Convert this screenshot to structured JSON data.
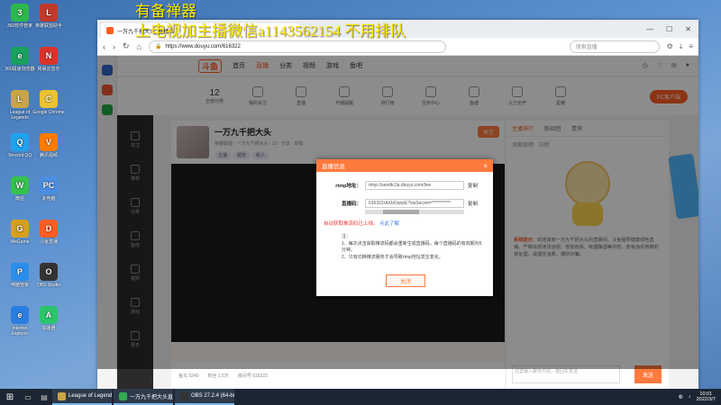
{
  "watermark": {
    "line1": "有备禅器",
    "line2": "上电视加主播微信a1143562154 不用排队"
  },
  "desktop_icons": [
    {
      "label": "360软件管家",
      "color": "#2db84d",
      "glyph": "3"
    },
    {
      "label": "360极速浏览器",
      "color": "#1aa15e",
      "glyph": "e"
    },
    {
      "label": "League of Legends",
      "color": "#caa546",
      "glyph": "L"
    },
    {
      "label": "Tencent QQ",
      "color": "#1fa2ef",
      "glyph": "Q"
    },
    {
      "label": "微信",
      "color": "#34c24d",
      "glyph": "W"
    },
    {
      "label": "WeGame",
      "color": "#d6a01d",
      "glyph": "G"
    },
    {
      "label": "电脑管家",
      "color": "#2b8eea",
      "glyph": "P"
    },
    {
      "label": "Internet Explorer",
      "color": "#2b7de0",
      "glyph": "e"
    },
    {
      "label": "英雄联盟助手",
      "color": "#c0392b",
      "glyph": "L"
    },
    {
      "label": "网易云音乐",
      "color": "#d9342b",
      "glyph": "N"
    },
    {
      "label": "Google Chrome",
      "color": "#eac233",
      "glyph": "C"
    },
    {
      "label": "腾讯视频",
      "color": "#ff7b00",
      "glyph": "V"
    },
    {
      "label": "此电脑",
      "color": "#4c8ee2",
      "glyph": "PC"
    },
    {
      "label": "斗鱼直播",
      "color": "#ff5d23",
      "glyph": "D"
    },
    {
      "label": "OBS Studio",
      "color": "#333333",
      "glyph": "O"
    },
    {
      "label": "加速器",
      "color": "#2bc46b",
      "glyph": "A"
    }
  ],
  "browser": {
    "tab_title": "一万九千把大头_直播间",
    "url": "https://www.douyu.com/616322",
    "search_placeholder": "搜索直播",
    "window_controls": [
      "—",
      "☐",
      "✕"
    ]
  },
  "site": {
    "logo": "斗鱼",
    "nav": [
      "首页",
      "直播",
      "分类",
      "视频",
      "游戏",
      "鱼吧"
    ],
    "categories": [
      {
        "label": "全部分类",
        "num": "12"
      },
      {
        "label": "我的关注",
        "num": ""
      },
      {
        "label": "直播",
        "num": ""
      },
      {
        "label": "开播提醒",
        "num": ""
      },
      {
        "label": "排行榜",
        "num": ""
      },
      {
        "label": "任务中心",
        "num": ""
      },
      {
        "label": "鱼塘",
        "num": ""
      },
      {
        "label": "火力全开",
        "num": ""
      },
      {
        "label": "星耀",
        "num": ""
      }
    ],
    "pc_button": "PC客户端",
    "sidebar": [
      "关注",
      "推荐",
      "分类",
      "鱼吧",
      "视频",
      "游戏",
      "更多"
    ],
    "room": {
      "title": "一万九千把大头",
      "subtitle": "英雄联盟 · 一万九千把大头 · 12 · 分享 · 举报",
      "tags": [
        "主播",
        "超管",
        "新人"
      ],
      "follow": "关注"
    },
    "right_tabs": [
      "主播排行",
      "粉丝团",
      "贵宾"
    ],
    "rank_text": "贡献周榜 · 日榜",
    "notice_prefix": "系统提示：",
    "notice_text": "欢迎来到一万九千把大头的直播间。斗鱼倡导健康绿色直播，严禁出现违法违规、低俗色情、吸烟酗酒等内容，若有违反将被封禁处理。请理性消费，谨防诈骗。",
    "chat_placeholder": "这里输入聊天内容，按回车发送",
    "send_button": "发送",
    "bottom_info": [
      "鱼丸 5240",
      "粉丝 1.5万",
      "房间号 616322"
    ]
  },
  "dialog": {
    "title": "直播信息",
    "close": "×",
    "rows": [
      {
        "label": "rtmp地址：",
        "value": "rtmp://sendtc3a.douyu.com/live",
        "action": "复制"
      },
      {
        "label": "直播码：",
        "value": "616322rAXbOqnpE?wsSecret=***********",
        "action": "复制"
      }
    ],
    "warn_text": "自动获取推流码已上线。",
    "link_text": "点此了解",
    "notes_title": "注：",
    "notes": [
      "1、每次点击获取推流码都会重新生成直播码，每个直播码的有效期为5分钟。",
      "2、只有切换推流服务才会导致rtmp地址发生变化。"
    ],
    "button": "关闭"
  },
  "taskbar": {
    "tasks": [
      {
        "label": "League of Legends",
        "color": "#caa546"
      },
      {
        "label": "一万九千把大头直...",
        "color": "#34a853"
      },
      {
        "label": "OBS 27.2.4 (64-bi...",
        "color": "#333333"
      }
    ],
    "time": "10:01",
    "date": "2022/3/7"
  }
}
